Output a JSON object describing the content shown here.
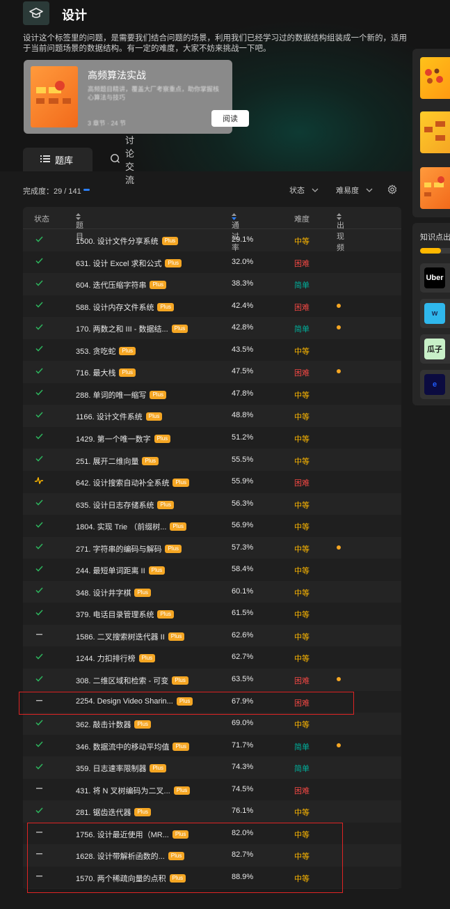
{
  "header": {
    "title": "设计",
    "description": "设计这个标签里的问题，是需要我们结合问题的场景，利用我们已经学习过的数据结构组装成一个新的，适用于当前问题场景的数据结构。有一定的难度，大家不妨来挑战一下吧。"
  },
  "featured_card": {
    "title": "高频算法实战",
    "subtitle": "高频题目精讲，覆盖大厂考察重点，助你掌握核心算法与技巧",
    "meta": "3 章节 · 24 节",
    "read_label": "阅读"
  },
  "tabs": [
    {
      "label": "题库",
      "icon": "list-icon",
      "active": true
    },
    {
      "label": "讨论交流",
      "icon": "discuss-icon",
      "active": false
    }
  ],
  "toolbar": {
    "progress_label": "完成度：29 / 141",
    "progress_fraction": 0.21,
    "status_filter": "状态",
    "difficulty_filter": "难易度",
    "settings_icon": "gear-icon"
  },
  "table": {
    "headers": {
      "status": "状态",
      "title": "题目",
      "rate": "通过率",
      "difficulty": "难度",
      "frequency": "出现频率"
    },
    "plus_label": "Plus",
    "rows": [
      {
        "status": "solved",
        "title": "1500. 设计文件分享系统",
        "rate": "29.1%",
        "difficulty": "中等",
        "level": "mid",
        "freq": false
      },
      {
        "status": "solved",
        "title": "631. 设计 Excel 求和公式",
        "rate": "32.0%",
        "difficulty": "困难",
        "level": "hard",
        "freq": false
      },
      {
        "status": "solved",
        "title": "604. 迭代压缩字符串",
        "rate": "38.3%",
        "difficulty": "简单",
        "level": "easy",
        "freq": false
      },
      {
        "status": "solved",
        "title": "588. 设计内存文件系统",
        "rate": "42.4%",
        "difficulty": "困难",
        "level": "hard",
        "freq": true
      },
      {
        "status": "solved",
        "title": "170. 两数之和 III - 数据结...",
        "rate": "42.8%",
        "difficulty": "简单",
        "level": "easy",
        "freq": true
      },
      {
        "status": "solved",
        "title": "353. 贪吃蛇",
        "rate": "43.5%",
        "difficulty": "中等",
        "level": "mid",
        "freq": false
      },
      {
        "status": "solved",
        "title": "716. 最大栈",
        "rate": "47.5%",
        "difficulty": "困难",
        "level": "hard",
        "freq": true
      },
      {
        "status": "solved",
        "title": "288. 单词的唯一缩写",
        "rate": "47.8%",
        "difficulty": "中等",
        "level": "mid",
        "freq": false
      },
      {
        "status": "solved",
        "title": "1166. 设计文件系统",
        "rate": "48.8%",
        "difficulty": "中等",
        "level": "mid",
        "freq": false
      },
      {
        "status": "solved",
        "title": "1429. 第一个唯一数字",
        "rate": "51.2%",
        "difficulty": "中等",
        "level": "mid",
        "freq": false
      },
      {
        "status": "solved",
        "title": "251. 展开二维向量",
        "rate": "55.5%",
        "difficulty": "中等",
        "level": "mid",
        "freq": false
      },
      {
        "status": "attempted",
        "title": "642. 设计搜索自动补全系统",
        "rate": "55.9%",
        "difficulty": "困难",
        "level": "hard",
        "freq": false
      },
      {
        "status": "solved",
        "title": "635. 设计日志存储系统",
        "rate": "56.3%",
        "difficulty": "中等",
        "level": "mid",
        "freq": false
      },
      {
        "status": "solved",
        "title": "1804. 实现 Trie （前缀树...",
        "rate": "56.9%",
        "difficulty": "中等",
        "level": "mid",
        "freq": false
      },
      {
        "status": "solved",
        "title": "271. 字符串的编码与解码",
        "rate": "57.3%",
        "difficulty": "中等",
        "level": "mid",
        "freq": true
      },
      {
        "status": "solved",
        "title": "244. 最短单词距离 II",
        "rate": "58.4%",
        "difficulty": "中等",
        "level": "mid",
        "freq": false
      },
      {
        "status": "solved",
        "title": "348. 设计井字棋",
        "rate": "60.1%",
        "difficulty": "中等",
        "level": "mid",
        "freq": false
      },
      {
        "status": "solved",
        "title": "379. 电话目录管理系统",
        "rate": "61.5%",
        "difficulty": "中等",
        "level": "mid",
        "freq": false
      },
      {
        "status": "none",
        "title": "1586. 二叉搜索树迭代器 II",
        "rate": "62.6%",
        "difficulty": "中等",
        "level": "mid",
        "freq": false
      },
      {
        "status": "solved",
        "title": "1244. 力扣排行榜",
        "rate": "62.7%",
        "difficulty": "中等",
        "level": "mid",
        "freq": false
      },
      {
        "status": "solved",
        "title": "308. 二维区域和检索 - 可变",
        "rate": "63.5%",
        "difficulty": "困难",
        "level": "hard",
        "freq": true
      },
      {
        "status": "none",
        "title": "2254. Design Video Sharin...",
        "rate": "67.9%",
        "difficulty": "困难",
        "level": "hard",
        "freq": false
      },
      {
        "status": "solved",
        "title": "362. 敲击计数器",
        "rate": "69.0%",
        "difficulty": "中等",
        "level": "mid",
        "freq": false
      },
      {
        "status": "solved",
        "title": "346. 数据流中的移动平均值",
        "rate": "71.7%",
        "difficulty": "简单",
        "level": "easy",
        "freq": true
      },
      {
        "status": "solved",
        "title": "359. 日志速率限制器",
        "rate": "74.3%",
        "difficulty": "简单",
        "level": "easy",
        "freq": false
      },
      {
        "status": "none",
        "title": "431. 将 N 叉树编码为二叉...",
        "rate": "74.5%",
        "difficulty": "困难",
        "level": "hard",
        "freq": false
      },
      {
        "status": "solved",
        "title": "281. 锯齿迭代器",
        "rate": "76.1%",
        "difficulty": "中等",
        "level": "mid",
        "freq": false
      },
      {
        "status": "none",
        "title": "1756. 设计最近使用（MR...",
        "rate": "82.0%",
        "difficulty": "中等",
        "level": "mid",
        "freq": false
      },
      {
        "status": "none",
        "title": "1628. 设计带解析函数的...",
        "rate": "82.7%",
        "difficulty": "中等",
        "level": "mid",
        "freq": false
      },
      {
        "status": "none",
        "title": "1570. 两个稀疏向量的点积",
        "rate": "88.9%",
        "difficulty": "中等",
        "level": "mid",
        "freq": false
      }
    ]
  },
  "sidebar": {
    "knowledge_title": "知识点出",
    "knowledge_fraction": 0.7,
    "companies": [
      {
        "name": "Uber",
        "logo_text": "Uber",
        "bg": "#000000",
        "fg": "#ffffff"
      },
      {
        "name": "Wish",
        "logo_text": "w",
        "bg": "#2fb7ec",
        "fg": "#1a2f5a"
      },
      {
        "name": "瓜子",
        "logo_text": "瓜子",
        "bg": "#c8f0c8",
        "fg": "#1a1a1a"
      },
      {
        "name": "中国电信",
        "logo_text": "e",
        "bg": "#0b0b40",
        "fg": "#1f5cff"
      }
    ]
  },
  "colors": {
    "mid": "#ffb800",
    "hard": "#ef4743",
    "easy": "#00af9b",
    "accent": "#2c7ff5",
    "plus": "#f5a623"
  }
}
